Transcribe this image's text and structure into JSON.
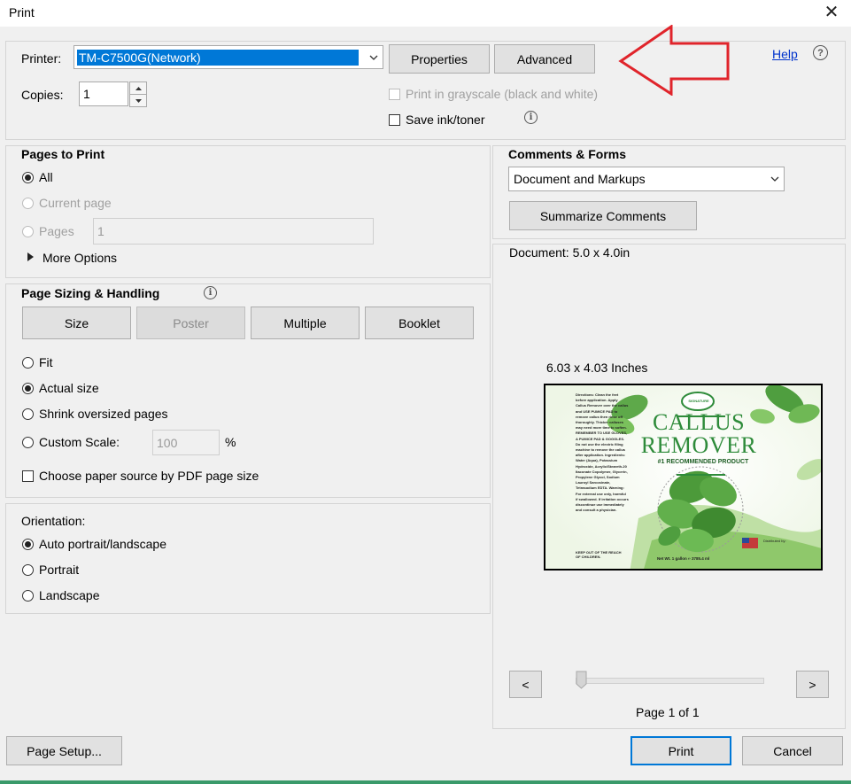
{
  "window": {
    "title": "Print",
    "close_glyph": "✕"
  },
  "printer": {
    "label": "Printer:",
    "value": "TM-C7500G(Network)",
    "properties_label": "Properties",
    "advanced_label": "Advanced",
    "help_label": "Help",
    "help_icon_glyph": "?",
    "copies_label": "Copies:",
    "copies_value": "1",
    "grayscale_label": "Print in grayscale (black and white)",
    "save_ink_label": "Save ink/toner"
  },
  "pages_to_print": {
    "heading": "Pages to Print",
    "all_label": "All",
    "current_label": "Current page",
    "pages_label": "Pages",
    "pages_value": "1",
    "more_options_label": "More Options"
  },
  "page_sizing": {
    "heading": "Page Sizing & Handling",
    "size_label": "Size",
    "poster_label": "Poster",
    "multiple_label": "Multiple",
    "booklet_label": "Booklet",
    "fit_label": "Fit",
    "actual_label": "Actual size",
    "shrink_label": "Shrink oversized pages",
    "custom_label": "Custom Scale:",
    "custom_value": "100",
    "percent": "%",
    "paper_source_label": "Choose paper source by PDF page size"
  },
  "orientation": {
    "heading": "Orientation:",
    "auto_label": "Auto portrait/landscape",
    "portrait_label": "Portrait",
    "landscape_label": "Landscape"
  },
  "comments_forms": {
    "heading": "Comments & Forms",
    "selected": "Document and Markups",
    "summarize_label": "Summarize Comments"
  },
  "preview": {
    "document_size": "Document: 5.0 x 4.0in",
    "page_size": "6.03 x 4.03 Inches",
    "prev_label": "<",
    "next_label": ">",
    "page_indicator": "Page 1 of 1",
    "slider_position": 0,
    "label_art": {
      "logo_text": "SIGNATURE",
      "title_line1": "CALLUS",
      "title_line2": "REMOVER",
      "subtitle": "#1 RECOMMENDED PRODUCT",
      "directions": "Directions: Clean the feet before application. Apply Callus Remover over the callus and USE PUMICE PAD to remove callus then rinse off thoroughly. Thicker calluses may need more time to soften. REMEMBER TO USE GLOVES, A PUMICE PAD & GOGGLES. Do not use the electric filing machine to remove the callus after application. Ingredients: Water (Aqua), Potassium Hydroxide, Acrylic/Steareth-20 Itaconate Copolymer, Glycerin, Propylene Glycol, Sodium Lauroyl Sarcosinate, Tetrasodium EDTA. Warning: For external use only, harmful if swallowed. If irritation occurs discontinue use immediately and consult a physician.",
      "keep_out": "KEEP OUT OF THE REACH OF CHILDREN.",
      "net_wt": "Net Wt. 1 gallon  ℮ 3785.4 ml",
      "distributed": "Distributed by:"
    }
  },
  "footer": {
    "page_setup_label": "Page Setup...",
    "print_label": "Print",
    "cancel_label": "Cancel"
  },
  "colors": {
    "accent_blue": "#0078d7",
    "annotation_arrow": "#e0242b",
    "label_green": "#2e8b3a"
  },
  "icons": {
    "dropdown": "chevron-down-icon",
    "info": "info-icon",
    "triangle": "triangle-right-icon",
    "arrow_annotation": "arrow-left-icon"
  }
}
